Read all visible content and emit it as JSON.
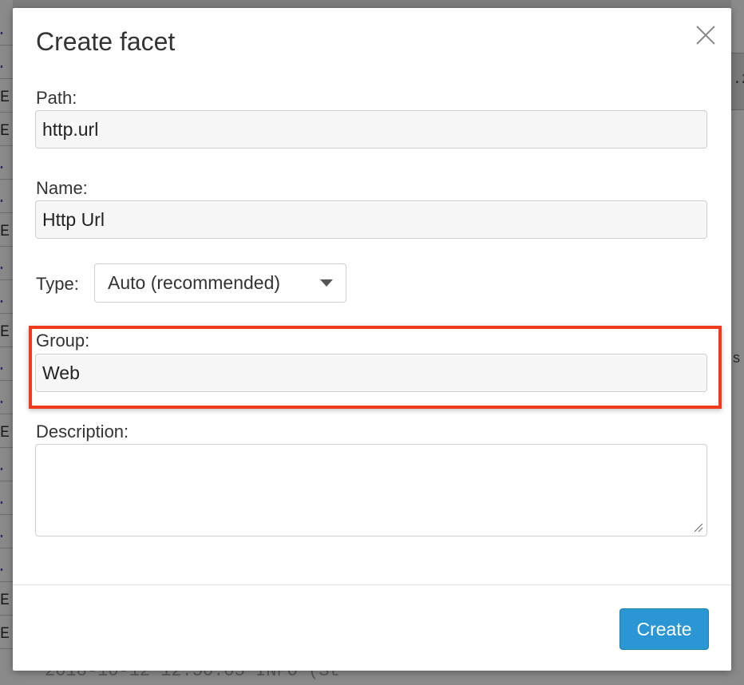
{
  "background": {
    "left_fragments": [
      ".",
      ".",
      "E",
      "E",
      ".",
      ".",
      "E",
      ".",
      ".",
      "E",
      ".",
      ".",
      "E",
      ".",
      ".",
      ".",
      ".",
      "E",
      "E"
    ],
    "bottom_text": "2018-10-12 12:50:05  INFO (St",
    "right_fragment_1": ".2",
    "right_fragment_2": "s"
  },
  "dialog": {
    "title": "Create facet",
    "path": {
      "label": "Path:",
      "value": "http.url"
    },
    "name": {
      "label": "Name:",
      "value": "Http Url"
    },
    "type": {
      "label": "Type:",
      "selected": "Auto (recommended)"
    },
    "group": {
      "label": "Group:",
      "value": "Web"
    },
    "description": {
      "label": "Description:",
      "value": ""
    },
    "create_label": "Create"
  },
  "colors": {
    "primary": "#2a96d3",
    "highlight": "#f03a1e"
  }
}
